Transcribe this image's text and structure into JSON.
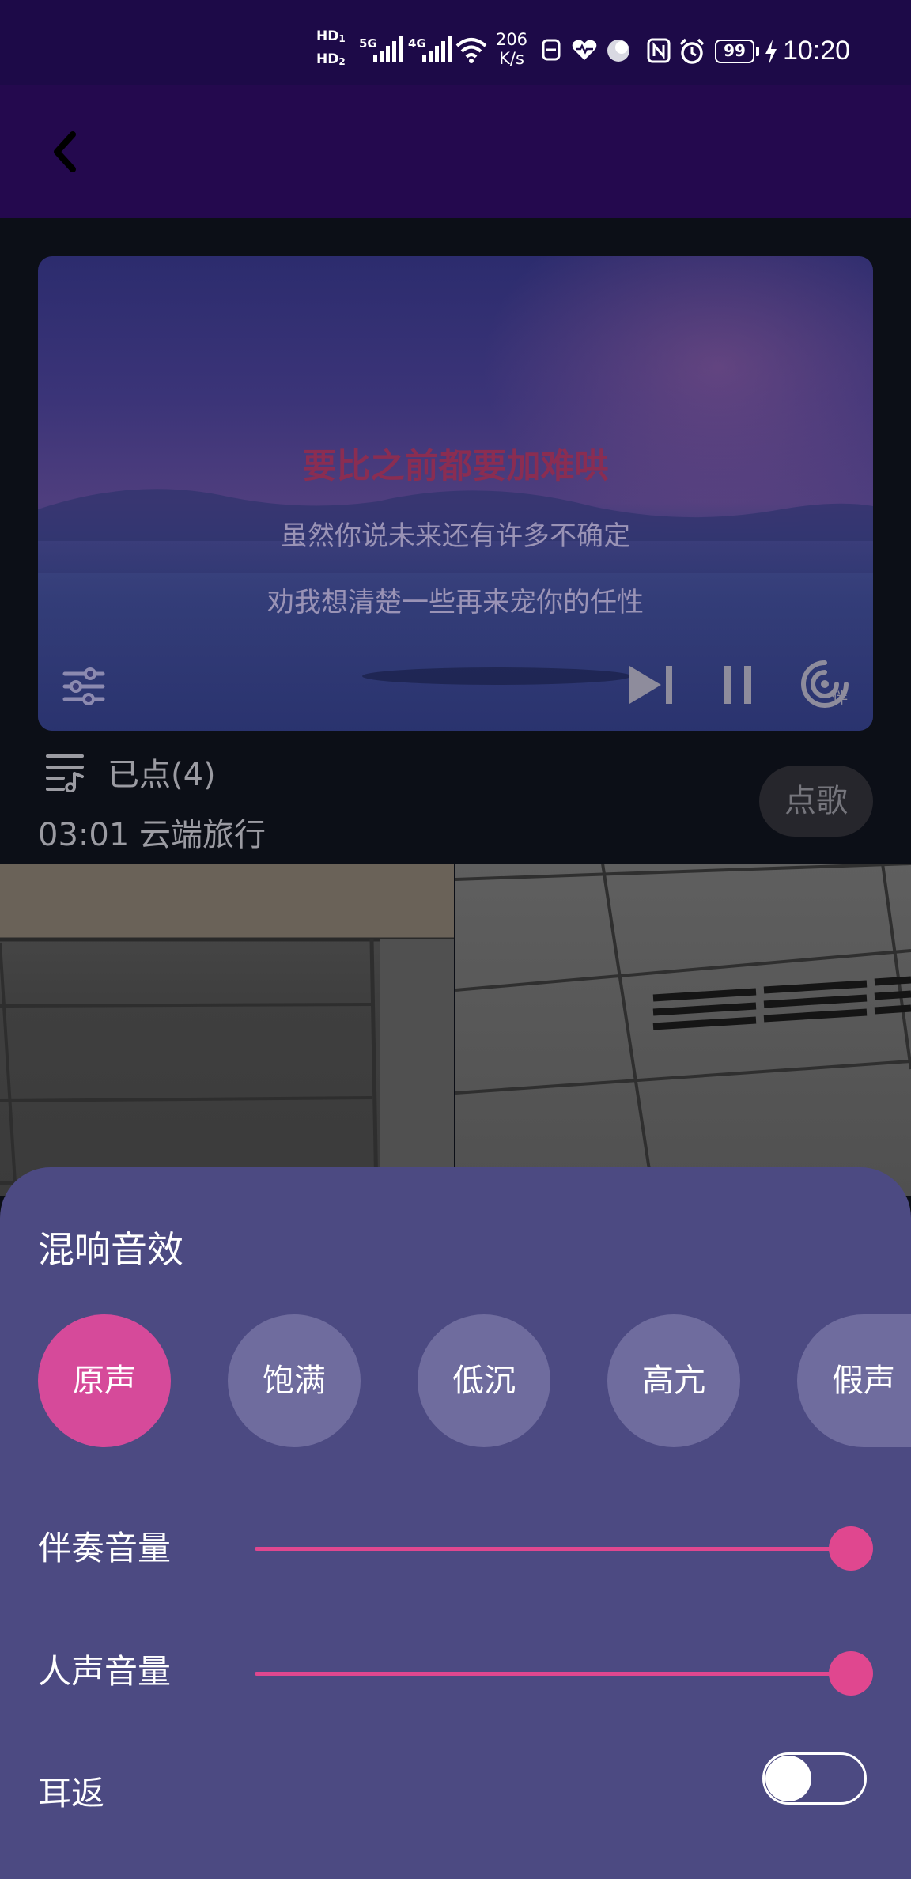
{
  "status_bar": {
    "hd1": "HD",
    "hd1_sub": "1",
    "hd2": "HD",
    "hd2_sub": "2",
    "net1": "5G",
    "net2": "4G",
    "speed_value": "206",
    "speed_unit": "K/s",
    "battery": "99",
    "time": "10:20"
  },
  "player": {
    "lyric_current": "要比之前都要加难哄",
    "lyric_next": "虽然你说未来还有许多不确定",
    "lyric_next2": "劝我想清楚一些再来宠你的任性",
    "companion_badge": "伴"
  },
  "queue": {
    "label": "已点(4)",
    "now_playing": "03:01 云端旅行",
    "order_button": "点歌"
  },
  "sheet": {
    "title": "混响音效",
    "presets": [
      "原声",
      "饱满",
      "低沉",
      "高亢",
      "假声"
    ],
    "active_preset": "原声",
    "accompaniment_label": "伴奏音量",
    "accompaniment_level": 1.0,
    "vocal_label": "人声音量",
    "vocal_level": 1.0,
    "ear_return_label": "耳返",
    "ear_return_on": false
  },
  "colors": {
    "status_bar": "#1d0a48",
    "header": "#24094e",
    "sheet": "#4c4a82",
    "accent": "#d64a9a",
    "preset_inactive": "#6f6c9e"
  }
}
